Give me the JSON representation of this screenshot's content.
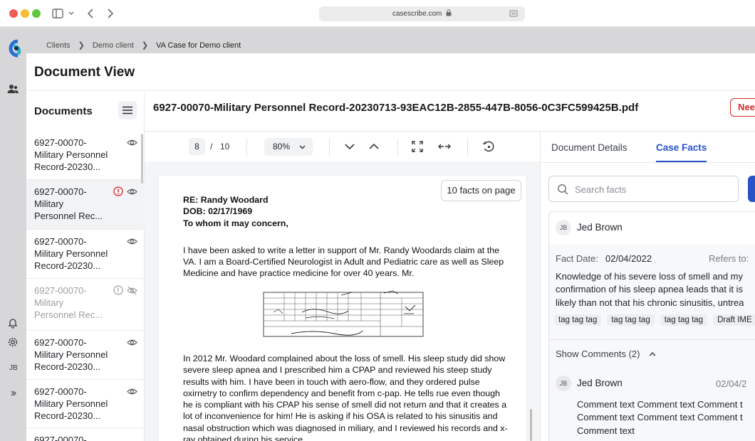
{
  "browser": {
    "url": "casescribe.com"
  },
  "breadcrumb": {
    "items": [
      "Clients",
      "Demo client",
      "VA Case for Demo client"
    ]
  },
  "page": {
    "title": "Document View"
  },
  "sidebar": {
    "heading": "Documents",
    "documents": [
      {
        "line1": "6927-00070-",
        "line2": "Military Personnel",
        "line3": "Record-20230..."
      },
      {
        "line1": "6927-00070-",
        "line2": "Military",
        "line3": "Personnel Rec..."
      },
      {
        "line1": "6927-00070-",
        "line2": "Military Personnel",
        "line3": "Record-20230..."
      },
      {
        "line1": "6927-00070-",
        "line2": "Military",
        "line3": "Personnel Rec..."
      },
      {
        "line1": "6927-00070-",
        "line2": "Military Personnel",
        "line3": "Record-20230..."
      },
      {
        "line1": "6927-00070-",
        "line2": "Military Personnel",
        "line3": "Record-20230..."
      },
      {
        "line1": "6927-00070-",
        "line2": "",
        "line3": ""
      }
    ]
  },
  "file": {
    "name": "6927-00070-Military Personnel Record-20230713-93EAC12B-2855-447B-8056-0C3FC599425B.pdf",
    "action_label": "Nee"
  },
  "toolbar": {
    "current_page": "8",
    "slash": "/",
    "total_pages": "10",
    "zoom": "80%"
  },
  "viewer": {
    "facts_badge": "10 facts on page",
    "re_line": "RE: Randy Woodard",
    "dob_line": "DOB: 02/17/1969",
    "salutation": "To whom it may concern,",
    "para1": "I have been asked to write a letter in support of Mr. Randy Woodards claim at the VA. I am a Board-Certified Neurologist in Adult and Pediatric care as well as Sleep Medicine and have practice medicine for over 40 years. Mr.",
    "para2": "In 2012 Mr. Woodard complained about the loss of smell. His sleep study did show severe sleep apnea and I prescribed him a CPAP and reviewed his steep study results with him. I have been in touch with aero-flow, and they ordered pulse oxirnetry to confirm dependency and benefit from c-pap. He tells rue even though he is compliant with his CPAP his sense of smell did not return and that it creates a lot of inconvenience for him! He is asking if his OSA is related to his sinusitis and nasal obstruction which was diagnosed in miliary, and I reviewed his records and x-ray obtained during his service."
  },
  "right_panel": {
    "tabs": [
      "Document Details",
      "Case Facts"
    ],
    "active_tab": "Case Facts",
    "search_placeholder": "Search facts",
    "fact": {
      "author_initials": "JB",
      "author": "Jed Brown",
      "date_label": "Fact Date:",
      "date_value": "02/04/2022",
      "refers_label": "Refers to:",
      "text_lines": [
        "Knowledge of his severe loss of smell and my",
        "confirmation of his sleep apnea leads that it is",
        "likely than not that his chronic sinusitis, untrea"
      ],
      "tags": [
        "tag tag tag",
        "tag tag tag",
        "tag tag tag",
        "Draft IME"
      ],
      "show_comments": "Show Comments (2)"
    },
    "comment": {
      "author_initials": "JB",
      "author": "Jed Brown",
      "date": "02/04/2",
      "text_lines": [
        "Comment text Comment text Comment t",
        "Comment text Comment text Comment t",
        "Comment text"
      ]
    }
  },
  "rail": {
    "user_initials": "JB"
  },
  "colors": {
    "accent": "#2753c7",
    "alert": "#d62828",
    "chrome_grey": "#d7d7d9"
  }
}
